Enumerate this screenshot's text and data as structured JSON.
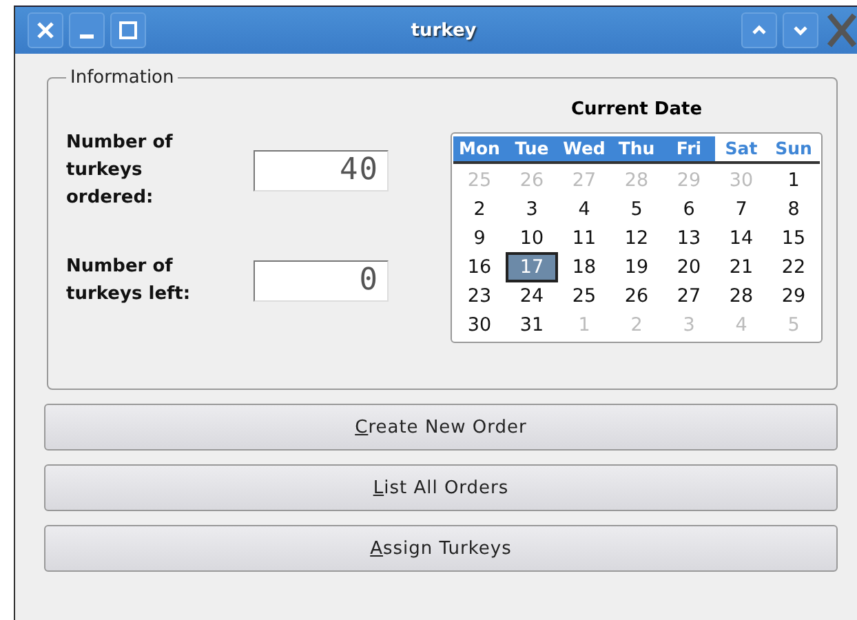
{
  "window": {
    "title": "turkey"
  },
  "group": {
    "legend": "Information"
  },
  "fields": [
    {
      "label": "Number of turkeys ordered:",
      "value": "40"
    },
    {
      "label": "Number of turkeys left:",
      "value": "0"
    }
  ],
  "calendar": {
    "title": "Current Date",
    "headers": [
      {
        "label": "Mon",
        "weekend": false
      },
      {
        "label": "Tue",
        "weekend": false
      },
      {
        "label": "Wed",
        "weekend": false
      },
      {
        "label": "Thu",
        "weekend": false
      },
      {
        "label": "Fri",
        "weekend": false
      },
      {
        "label": "Sat",
        "weekend": true
      },
      {
        "label": "Sun",
        "weekend": true
      }
    ],
    "weeks": [
      [
        {
          "day": "25",
          "in_month": false,
          "selected": false
        },
        {
          "day": "26",
          "in_month": false,
          "selected": false
        },
        {
          "day": "27",
          "in_month": false,
          "selected": false
        },
        {
          "day": "28",
          "in_month": false,
          "selected": false
        },
        {
          "day": "29",
          "in_month": false,
          "selected": false
        },
        {
          "day": "30",
          "in_month": false,
          "selected": false
        },
        {
          "day": "1",
          "in_month": true,
          "selected": false
        }
      ],
      [
        {
          "day": "2",
          "in_month": true,
          "selected": false
        },
        {
          "day": "3",
          "in_month": true,
          "selected": false
        },
        {
          "day": "4",
          "in_month": true,
          "selected": false
        },
        {
          "day": "5",
          "in_month": true,
          "selected": false
        },
        {
          "day": "6",
          "in_month": true,
          "selected": false
        },
        {
          "day": "7",
          "in_month": true,
          "selected": false
        },
        {
          "day": "8",
          "in_month": true,
          "selected": false
        }
      ],
      [
        {
          "day": "9",
          "in_month": true,
          "selected": false
        },
        {
          "day": "10",
          "in_month": true,
          "selected": false
        },
        {
          "day": "11",
          "in_month": true,
          "selected": false
        },
        {
          "day": "12",
          "in_month": true,
          "selected": false
        },
        {
          "day": "13",
          "in_month": true,
          "selected": false
        },
        {
          "day": "14",
          "in_month": true,
          "selected": false
        },
        {
          "day": "15",
          "in_month": true,
          "selected": false
        }
      ],
      [
        {
          "day": "16",
          "in_month": true,
          "selected": false
        },
        {
          "day": "17",
          "in_month": true,
          "selected": true
        },
        {
          "day": "18",
          "in_month": true,
          "selected": false
        },
        {
          "day": "19",
          "in_month": true,
          "selected": false
        },
        {
          "day": "20",
          "in_month": true,
          "selected": false
        },
        {
          "day": "21",
          "in_month": true,
          "selected": false
        },
        {
          "day": "22",
          "in_month": true,
          "selected": false
        }
      ],
      [
        {
          "day": "23",
          "in_month": true,
          "selected": false
        },
        {
          "day": "24",
          "in_month": true,
          "selected": false
        },
        {
          "day": "25",
          "in_month": true,
          "selected": false
        },
        {
          "day": "26",
          "in_month": true,
          "selected": false
        },
        {
          "day": "27",
          "in_month": true,
          "selected": false
        },
        {
          "day": "28",
          "in_month": true,
          "selected": false
        },
        {
          "day": "29",
          "in_month": true,
          "selected": false
        }
      ],
      [
        {
          "day": "30",
          "in_month": true,
          "selected": false
        },
        {
          "day": "31",
          "in_month": true,
          "selected": false
        },
        {
          "day": "1",
          "in_month": false,
          "selected": false
        },
        {
          "day": "2",
          "in_month": false,
          "selected": false
        },
        {
          "day": "3",
          "in_month": false,
          "selected": false
        },
        {
          "day": "4",
          "in_month": false,
          "selected": false
        },
        {
          "day": "5",
          "in_month": false,
          "selected": false
        }
      ]
    ]
  },
  "buttons": [
    {
      "label": "Create New Order",
      "underline_first": true
    },
    {
      "label": "List All Orders",
      "underline_first": true
    },
    {
      "label": "Assign Turkeys",
      "underline_first": true
    }
  ]
}
